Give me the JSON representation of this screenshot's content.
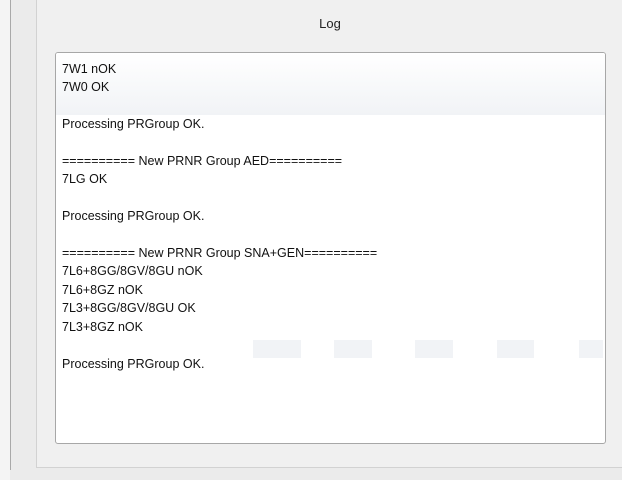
{
  "panel": {
    "title": "Log"
  },
  "log": {
    "lines": [
      "7W1 nOK",
      "7W0 OK",
      "",
      "Processing PRGroup OK.",
      "",
      "========== New PRNR Group AED==========",
      "7LG OK",
      "",
      "Processing PRGroup OK.",
      "",
      "========== New PRNR Group SNA+GEN==========",
      "7L6+8GG/8GV/8GU nOK",
      "7L6+8GZ nOK",
      "7L3+8GG/8GV/8GU OK",
      "7L3+8GZ nOK",
      "",
      "Processing PRGroup OK."
    ]
  }
}
